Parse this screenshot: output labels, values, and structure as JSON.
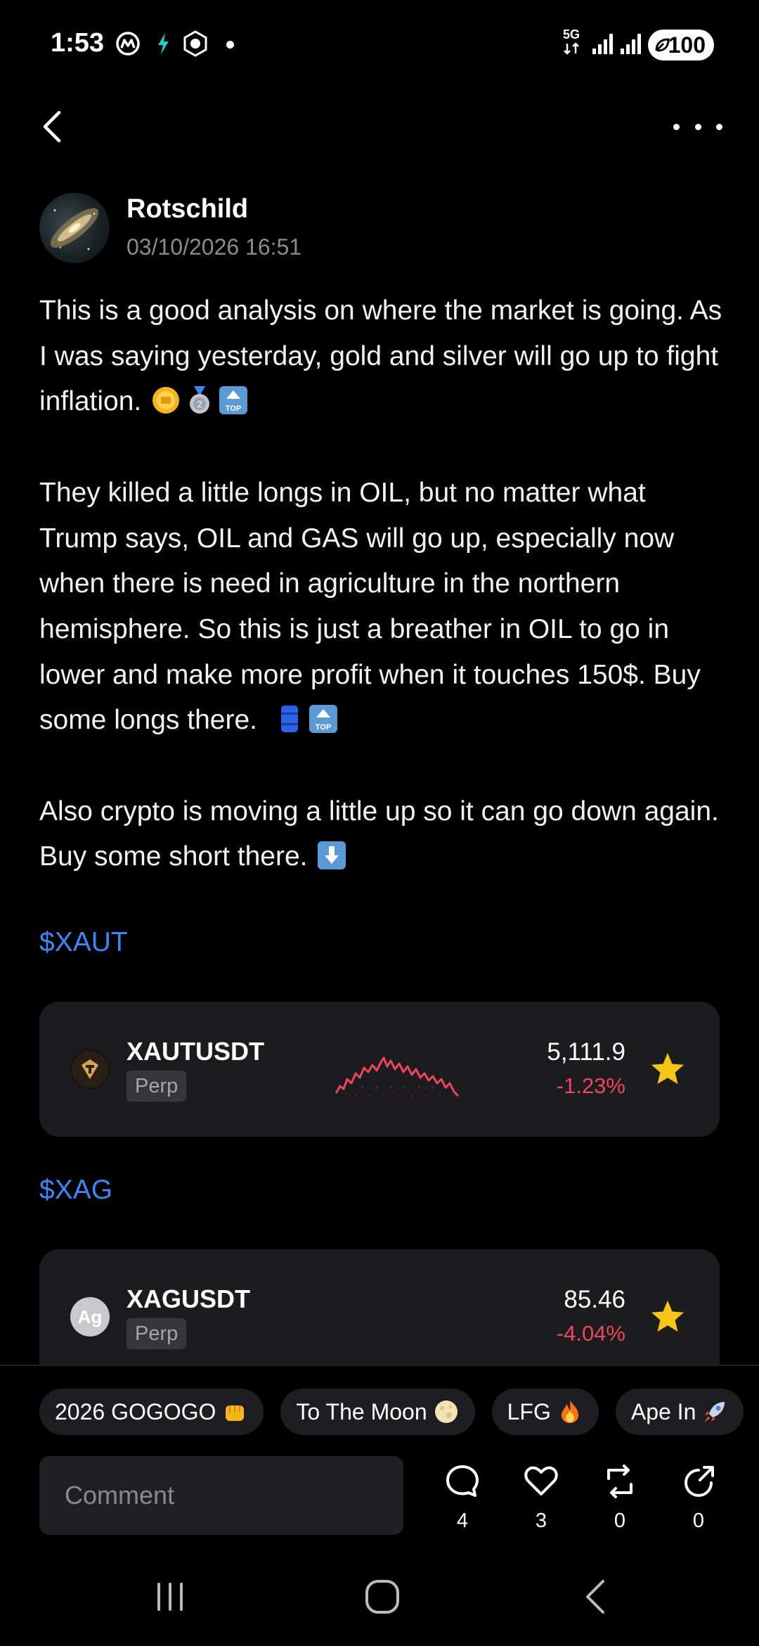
{
  "status_bar": {
    "time": "1:53",
    "network": "5G",
    "battery": "100"
  },
  "header": {
    "back_icon": "chevron-left-icon",
    "more_icon": "more-horizontal-icon"
  },
  "author": {
    "name": "Rotschild",
    "datetime": "03/10/2026 16:51"
  },
  "post": {
    "paragraph1": "This is a good analysis on where the market is going. As I was saying yesterday, gold and silver will go up to fight inflation.",
    "paragraph2": "They killed a little longs in OIL, but no matter what Trump says, OIL and GAS will go up, especially now when there is need in agriculture in the northern hemisphere. So this is just a breather in OIL to go in lower and make more profit when it touches 150$. Buy some longs there.",
    "paragraph3": "Also crypto is moving a little up so it can go down again. Buy some short there."
  },
  "tickers": [
    {
      "tag": "$XAUT",
      "pair": "XAUTUSDT",
      "badge": "Perp",
      "price": "5,111.9",
      "change": "-1.23%",
      "favorite": true
    },
    {
      "tag": "$XAG",
      "pair": "XAGUSDT",
      "badge": "Perp",
      "icon_text": "Ag",
      "price": "85.46",
      "change": "-4.04%",
      "favorite": true
    }
  ],
  "quick_replies": [
    "2026 GOGOGO",
    "To The Moon",
    "LFG",
    "Ape In"
  ],
  "comment": {
    "placeholder": "Comment"
  },
  "actions": {
    "comments": "4",
    "likes": "3",
    "reposts": "0",
    "shares": "0"
  },
  "colors": {
    "background": "#000000",
    "card": "#1c1c1f",
    "link": "#3d86f5",
    "negative": "#f0455e",
    "star": "#f5c518"
  }
}
